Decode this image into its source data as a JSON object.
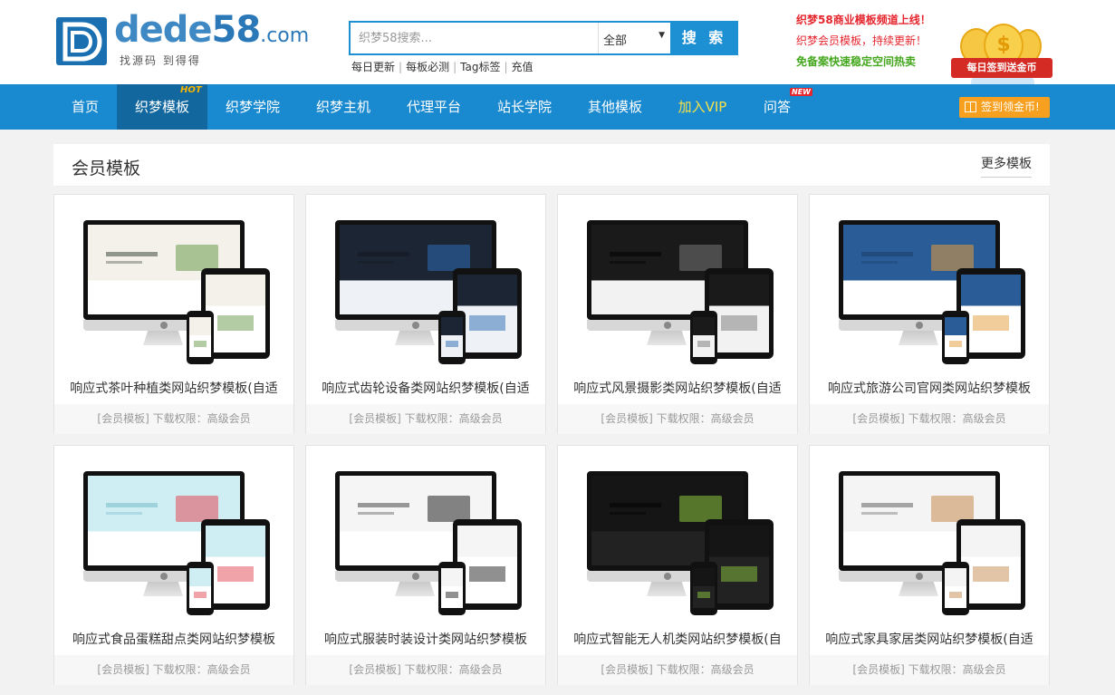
{
  "logo": {
    "name_a": "dede",
    "name_b": "58",
    "domain": ".com",
    "slogan": "找源码 到得得"
  },
  "search": {
    "placeholder": "织梦58搜索...",
    "scope": "全部",
    "button": "搜 索"
  },
  "quick_links": [
    "每日更新",
    "每板必测",
    "Tag标签",
    "充值"
  ],
  "promo": {
    "line1": "织梦58商业模板频道上线！",
    "line2": "织梦会员模板，持续更新！",
    "line3": "免备案快速稳定空间热卖"
  },
  "badge": {
    "coin_symbol": "$",
    "ribbon": "每日签到送金币"
  },
  "nav": {
    "items": [
      {
        "label": "首页"
      },
      {
        "label": "织梦模板",
        "tag": "HOT"
      },
      {
        "label": "织梦学院"
      },
      {
        "label": "织梦主机"
      },
      {
        "label": "代理平台"
      },
      {
        "label": "站长学院"
      },
      {
        "label": "其他模板"
      },
      {
        "label": "加入VIP"
      },
      {
        "label": "问答",
        "tag": "NEW"
      }
    ],
    "signin": "签到领金币!"
  },
  "section": {
    "title": "会员模板",
    "more": "更多模板"
  },
  "cards": [
    {
      "title": "响应式茶叶种植类网站织梦模板(自适",
      "meta": "[会员模板] 下载权限：高级会员",
      "theme": "tea"
    },
    {
      "title": "响应式齿轮设备类网站织梦模板(自适",
      "meta": "[会员模板] 下载权限：高级会员",
      "theme": "gear"
    },
    {
      "title": "响应式风景摄影类网站织梦模板(自适",
      "meta": "[会员模板] 下载权限：高级会员",
      "theme": "photo"
    },
    {
      "title": "响应式旅游公司官网类网站织梦模板",
      "meta": "[会员模板] 下载权限：高级会员",
      "theme": "travel"
    },
    {
      "title": "响应式食品蛋糕甜点类网站织梦模板",
      "meta": "[会员模板] 下载权限：高级会员",
      "theme": "cake"
    },
    {
      "title": "响应式服装时装设计类网站织梦模板",
      "meta": "[会员模板] 下载权限：高级会员",
      "theme": "fashion"
    },
    {
      "title": "响应式智能无人机类网站织梦模板(自",
      "meta": "[会员模板] 下载权限：高级会员",
      "theme": "drone"
    },
    {
      "title": "响应式家具家居类网站织梦模板(自适",
      "meta": "[会员模板] 下载权限：高级会员",
      "theme": "furniture"
    }
  ],
  "colors": {
    "brand_blue": "#1a8ad0",
    "nav_active": "#12679f",
    "vip_yellow": "#f4e14a",
    "promo_red": "#e5262e",
    "promo_green": "#44a71e",
    "signin_orange": "#f79f1e"
  }
}
